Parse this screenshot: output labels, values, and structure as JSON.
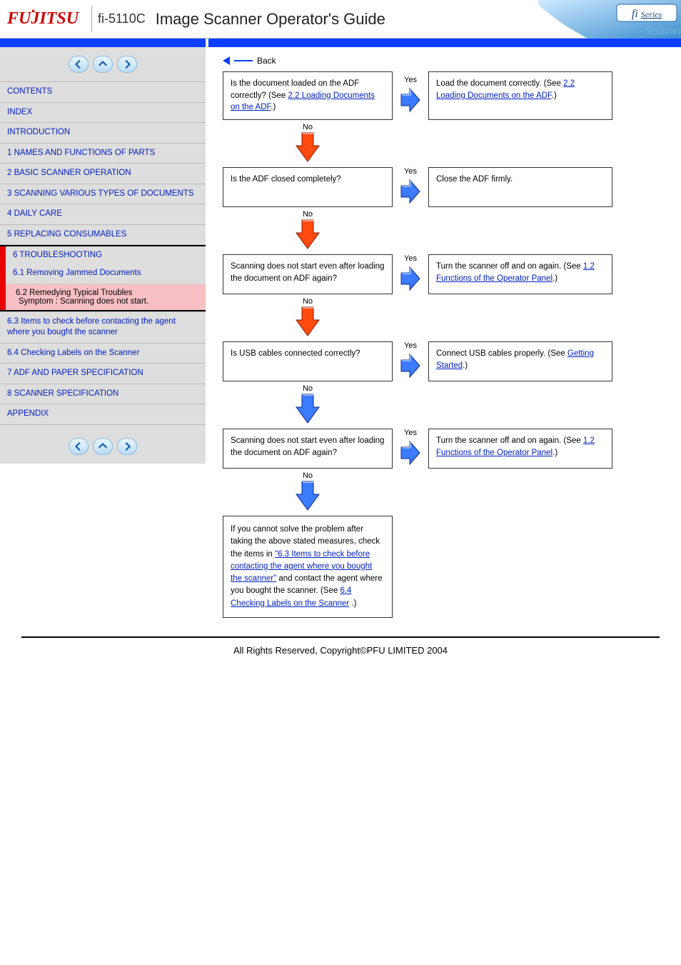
{
  "header": {
    "brand": "FUJITSU",
    "model": "fi-5110C",
    "title": "Image Scanner Operator's Guide",
    "series_label": "fi Series"
  },
  "sidebar": {
    "top_links": [
      "CONTENTS",
      "INDEX",
      "INTRODUCTION",
      "1 NAMES AND FUNCTIONS OF PARTS",
      "2 BASIC SCANNER OPERATION",
      "3 SCANNING VARIOUS TYPES OF DOCUMENTS",
      "4 DAILY CARE",
      "5 REPLACING CONSUMABLES"
    ],
    "chapter": {
      "title": "6 TROUBLESHOOTING",
      "subitem": "6.1 Removing Jammed Documents",
      "selected": {
        "title": "6.2 Remedying Typical Troubles",
        "sub": "Symptom : Scanning does not start."
      }
    },
    "bottom_links": [
      "6.3 Items to check before contacting the agent where you bought the scanner",
      "6.4 Checking Labels on the Scanner",
      "7 ADF AND PAPER SPECIFICATION",
      "8 SCANNER SPECIFICATION",
      "APPENDIX"
    ]
  },
  "flow": {
    "back_label": "Back",
    "steps": [
      {
        "q_parts": [
          "Is the document loaded on the ADF correctly? (See ",
          "2.2 Loading Documents on the ADF",
          ".)"
        ],
        "a_parts": [
          "Load the document correctly. (See ",
          "2.2 Loading Documents on the ADF",
          ".)"
        ],
        "yes": "Yes",
        "no": "No"
      },
      {
        "q_parts": [
          "Is the ADF closed completely?"
        ],
        "a_parts": [
          "Close the ADF firmly."
        ],
        "yes": "Yes",
        "no": "No"
      },
      {
        "q_parts": [
          "Scanning does not start even after loading the document on ADF again?"
        ],
        "a_parts": [
          "Turn the scanner off and on again. (See ",
          "1.2 Functions of the Operator Panel",
          ".)"
        ],
        "yes": "Yes",
        "no": "No"
      },
      {
        "q_parts": [
          "Is USB cables connected correctly?"
        ],
        "a_parts": [
          "Connect USB cables properly. (See ",
          "Getting Started",
          ".)"
        ],
        "yes": "Yes",
        "no": "No"
      },
      {
        "q_parts": [
          "Scanning does not start even after loading the document on ADF again?"
        ],
        "a_parts": [
          "Turn the scanner off and on again. (See ",
          "1.2 Functions of the Operator Panel",
          ".)"
        ],
        "yes": "Yes",
        "no": "No"
      }
    ],
    "final": {
      "lead": "If you cannot solve the problem after taking the above stated measures, check the items in ",
      "link1": "\"6.3 Items to check before contacting the agent where you bought the scanner\"",
      "mid": " and contact the agent where you bought the scanner. (See ",
      "link2": "6.4 Checking Labels on the Scanner",
      "tail": ".)"
    }
  },
  "colors": {
    "arrow_no_fill": "#ff4a10",
    "arrow_no_stroke": "#8a1c00",
    "arrow_yes_fill": "#3b7bff",
    "arrow_yes_stroke": "#0b2a88",
    "arrow_side_fill": "#3b7bff",
    "arrow_side_stroke": "#0b2a88"
  },
  "footer": {
    "copyright": "All Rights Reserved, Copyright©PFU LIMITED 2004"
  }
}
